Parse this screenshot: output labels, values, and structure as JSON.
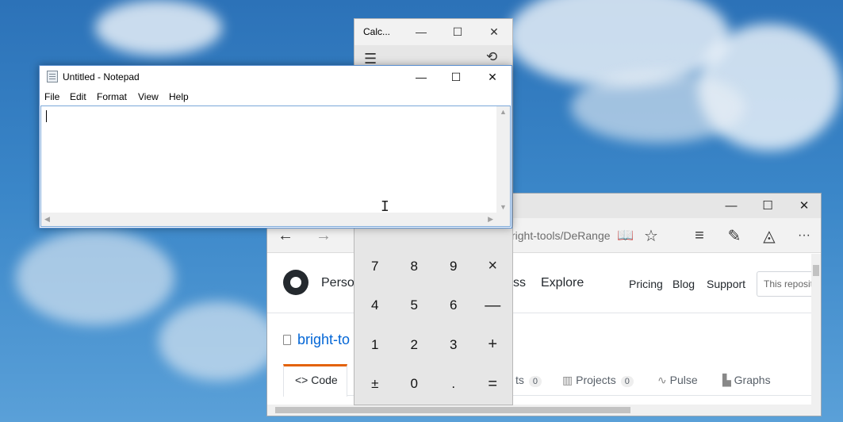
{
  "calculator": {
    "title": "Calc...",
    "controls": {
      "minimize": "—",
      "maximize": "☐",
      "close": "✕"
    },
    "menu_glyph": "☰",
    "history_glyph": "⟲",
    "keys": [
      "7",
      "8",
      "9",
      "×",
      "4",
      "5",
      "6",
      "—",
      "1",
      "2",
      "3",
      "+",
      "±",
      "0",
      ".",
      "="
    ]
  },
  "notepad": {
    "title": "Untitled - Notepad",
    "controls": {
      "minimize": "—",
      "maximize": "☐",
      "close": "✕"
    },
    "menu": [
      "File",
      "Edit",
      "Format",
      "View",
      "Help"
    ],
    "content": ""
  },
  "edge": {
    "controls": {
      "minimize": "—",
      "maximize": "☐",
      "close": "✕"
    },
    "nav": {
      "back": "←",
      "forward": "→"
    },
    "address": "right-tools/DeRange",
    "toolbar_icons": [
      "📖",
      "☆",
      "≡",
      "✎",
      "◬",
      "···"
    ],
    "github": {
      "header_links": {
        "personal": "Perso",
        "business": "ss",
        "explore": "Explore",
        "pricing": "Pricing",
        "blog": "Blog",
        "support": "Support"
      },
      "search_placeholder": "This reposit",
      "repo_title": "bright-to",
      "tabs": {
        "code": "<> Code",
        "issues_fragment": "ts",
        "issues_count": "0",
        "projects": "Projects",
        "projects_count": "0",
        "pulse": "Pulse",
        "graphs": "Graphs"
      }
    }
  },
  "colors": {
    "desktop": "#3a86c8",
    "calc_bg": "#e6e6e6",
    "notepad_border": "#5a8fd0",
    "gh_link": "#0366d6",
    "tab_accent": "#e36209"
  }
}
